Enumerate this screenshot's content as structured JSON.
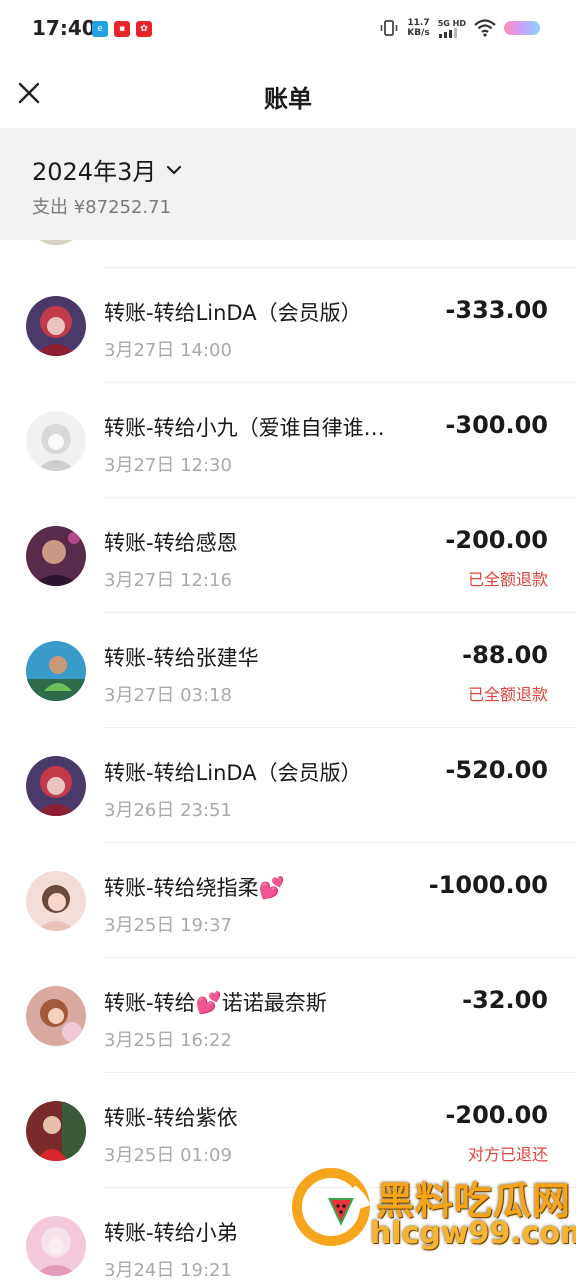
{
  "status_bar": {
    "time": "17:40",
    "net_speed": "11.7",
    "net_unit": "KB/s",
    "net_type": "5G HD",
    "app_icons": [
      "app-icon-blue",
      "app-icon-red",
      "app-icon-red-2"
    ]
  },
  "nav": {
    "title": "账单",
    "close_icon": "close-icon"
  },
  "month": {
    "label": "2024年3月",
    "summary": "支出 ¥87252.71"
  },
  "transactions": [
    {
      "title": "转账-转给LinDA（会员版）",
      "date": "3月27日 14:00",
      "amount": "-333.00",
      "status": ""
    },
    {
      "title": "转账-转给小九（爱谁自律谁…",
      "date": "3月27日 12:30",
      "amount": "-300.00",
      "status": ""
    },
    {
      "title": "转账-转给感恩",
      "date": "3月27日 12:16",
      "amount": "-200.00",
      "status": "已全额退款"
    },
    {
      "title": "转账-转给张建华",
      "date": "3月27日 03:18",
      "amount": "-88.00",
      "status": "已全额退款"
    },
    {
      "title": "转账-转给LinDA（会员版）",
      "date": "3月26日 23:51",
      "amount": "-520.00",
      "status": ""
    },
    {
      "title": "转账-转给绕指柔💕",
      "date": "3月25日 19:37",
      "amount": "-1000.00",
      "status": ""
    },
    {
      "title": "转账-转给💕诺诺最奈斯",
      "date": "3月25日 16:22",
      "amount": "-32.00",
      "status": ""
    },
    {
      "title": "转账-转给紫依",
      "date": "3月25日 01:09",
      "amount": "-200.00",
      "status": "对方已退还"
    },
    {
      "title": "转账-转给小弟",
      "date": "3月24日 19:21",
      "amount": "",
      "status": ""
    }
  ],
  "watermark": {
    "text": "黑料吃瓜网",
    "url": "hlcgw99.com"
  },
  "colors": {
    "refund_red": "#e0443d",
    "header_bg": "#f2f2f2",
    "watermark_gold": "#f4a51c"
  }
}
